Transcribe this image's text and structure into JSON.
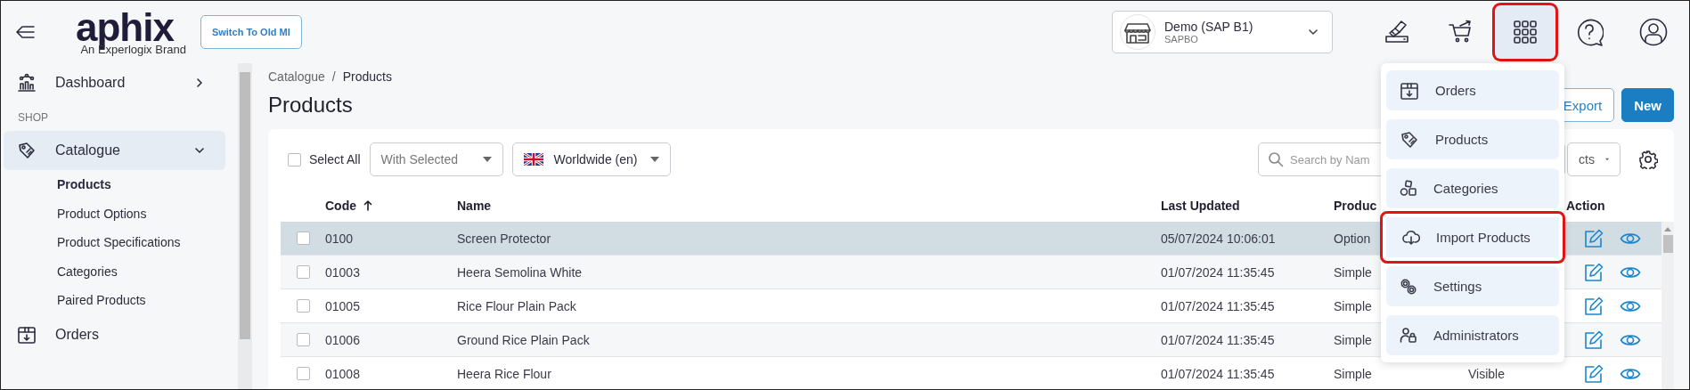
{
  "header": {
    "logo": "aphix",
    "tagline": "An Experlogix Brand",
    "switch_button": "Switch To Old MI",
    "store": {
      "name": "Demo (SAP B1)",
      "sub": "SAPBO"
    },
    "icons": [
      {
        "highlighted": false,
        "selected": false
      },
      {
        "highlighted": false,
        "selected": false
      },
      {
        "highlighted": true,
        "selected": true
      },
      {
        "highlighted": false,
        "selected": false
      },
      {
        "highlighted": false,
        "selected": false
      }
    ]
  },
  "sidebar": {
    "items": [
      {
        "kind": "link",
        "label": "Dashboard",
        "expanded": false,
        "selected": false
      },
      {
        "kind": "section",
        "label": "SHOP"
      },
      {
        "kind": "link",
        "label": "Catalogue",
        "expanded": true,
        "selected": true,
        "children": [
          {
            "label": "Products",
            "selected": true
          },
          {
            "label": "Product Options",
            "selected": false
          },
          {
            "label": "Product Specifications",
            "selected": false
          },
          {
            "label": "Categories",
            "selected": false
          },
          {
            "label": "Paired Products",
            "selected": false
          }
        ]
      },
      {
        "kind": "link",
        "label": "Orders",
        "selected": false
      }
    ]
  },
  "breadcrumb": {
    "separator": "/",
    "items": [
      "Catalogue",
      "Products"
    ]
  },
  "title": "Products",
  "actions": [
    "Export",
    "New"
  ],
  "toolbar": {
    "select_all": {
      "label": "Select All",
      "checked": false
    },
    "bulk_action": {
      "placeholder": "With Selected"
    },
    "locale": {
      "value": "Worldwide (en)"
    },
    "search": {
      "placeholder": "Search by Nam"
    },
    "filter": {
      "value": "cts"
    }
  },
  "table": {
    "columns": [
      {
        "label": "Code",
        "sort_ascending": true
      },
      {
        "label": "Name"
      },
      {
        "label": "Last Updated"
      },
      {
        "label": "Produc"
      },
      {},
      {
        "label": "Action"
      }
    ],
    "rows": [
      {
        "code": "0100",
        "name": "Screen Protector",
        "updated": "05/07/2024 10:06:01",
        "type": "Option",
        "selected": true,
        "checked": false
      },
      {
        "code": "01003",
        "name": "Heera Semolina White",
        "updated": "01/07/2024 11:35:45",
        "type": "Simple",
        "selected": false,
        "checked": false
      },
      {
        "code": "01005",
        "name": "Rice Flour Plain Pack",
        "updated": "01/07/2024 11:35:45",
        "type": "Simple",
        "selected": false,
        "checked": false
      },
      {
        "code": "01006",
        "name": "Ground Rice Plain Pack",
        "updated": "01/07/2024 11:35:45",
        "type": "Simple",
        "selected": false,
        "checked": false
      },
      {
        "code": "01008",
        "name": "Heera Rice Flour",
        "updated": "01/07/2024 11:35:45",
        "type": "Simple",
        "visibility": "Visible",
        "selected": false,
        "checked": false
      }
    ]
  },
  "menu": {
    "items": [
      {
        "label": "Orders",
        "highlighted": false
      },
      {
        "label": "Products",
        "highlighted": false
      },
      {
        "label": "Categories",
        "highlighted": false
      },
      {
        "label": "Import Products",
        "highlighted": true
      },
      {
        "label": "Settings",
        "highlighted": false
      },
      {
        "label": "Administrators",
        "highlighted": false
      }
    ]
  }
}
